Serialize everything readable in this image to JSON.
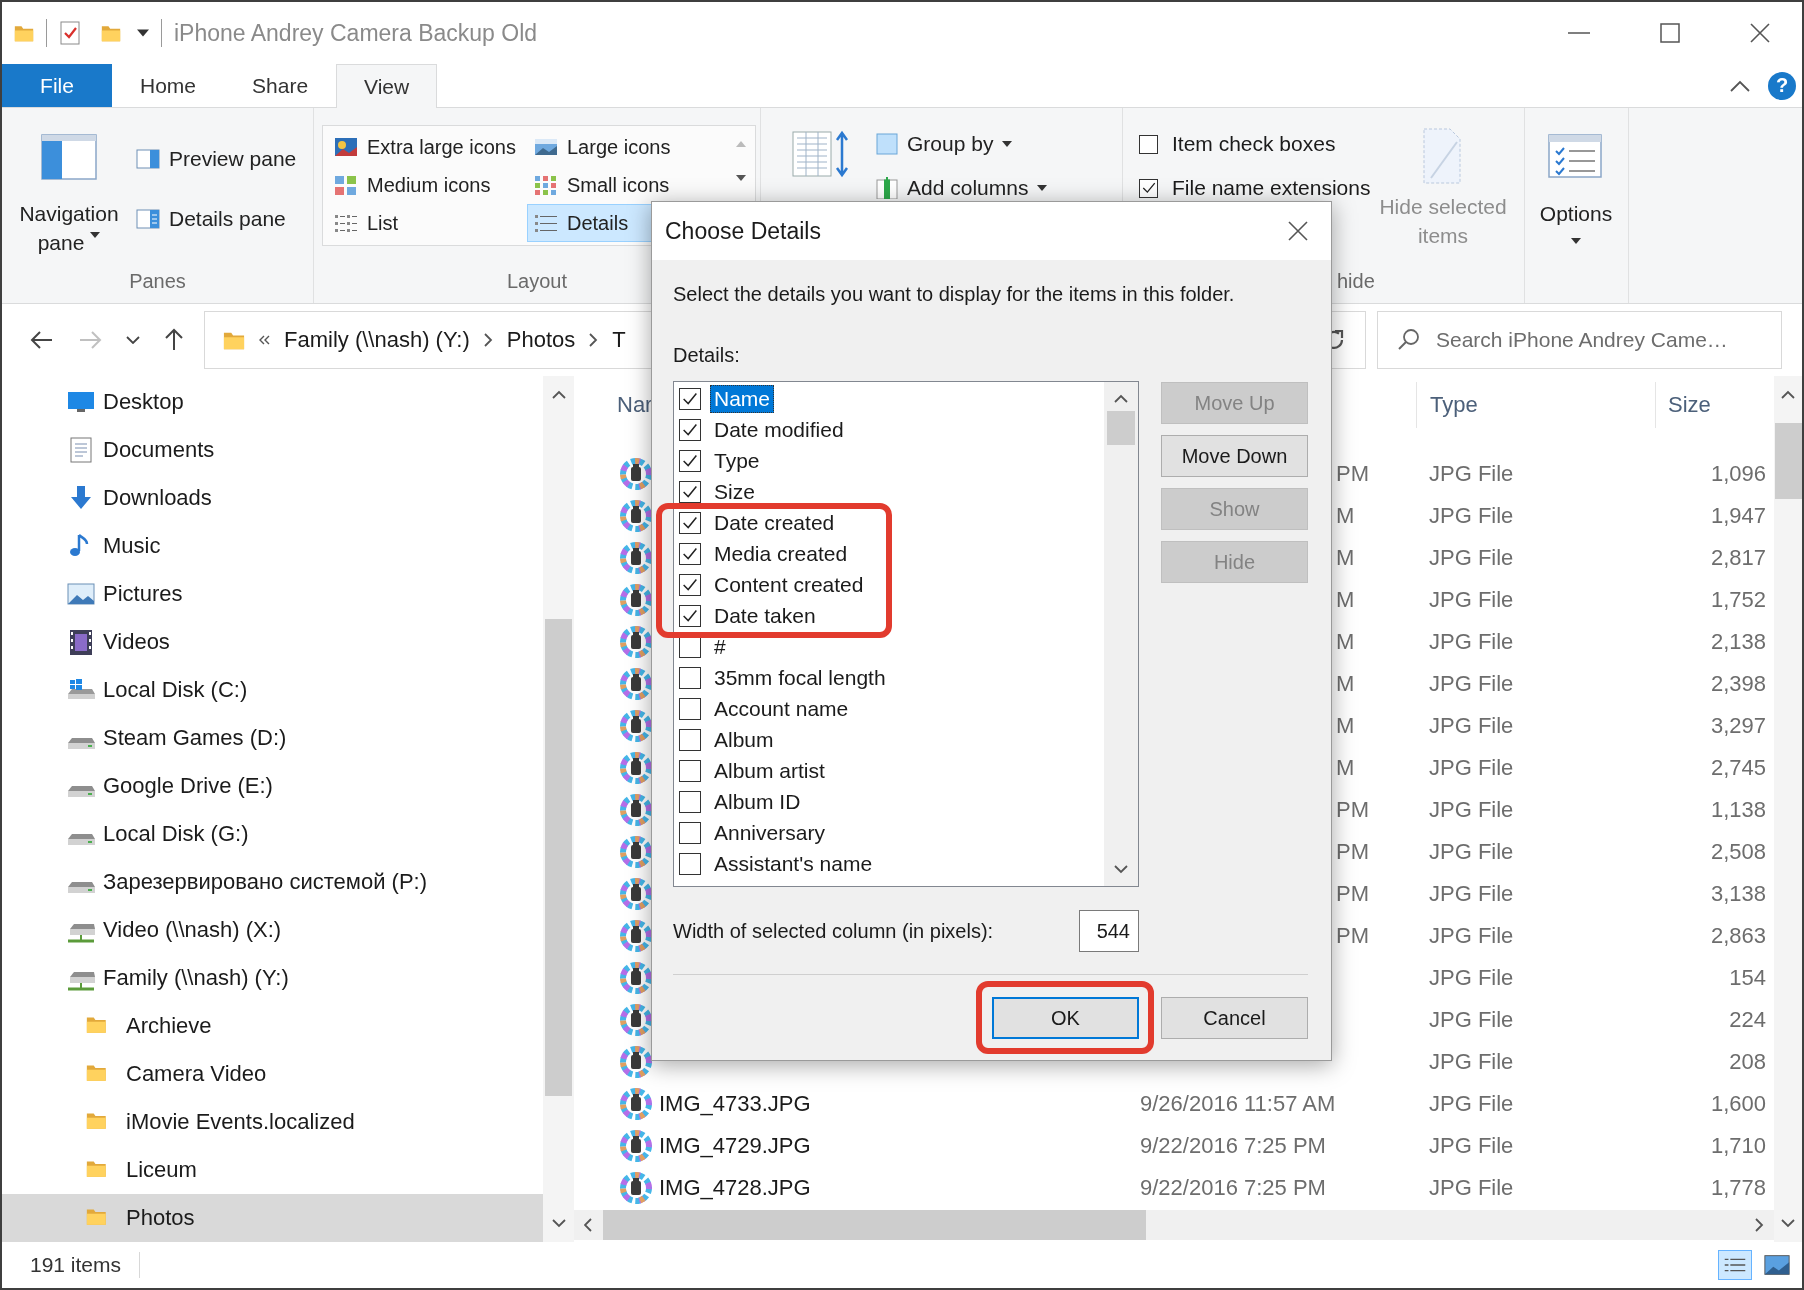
{
  "window": {
    "title": "iPhone Andrey Camera Backup Old"
  },
  "ribbon": {
    "tabs": [
      {
        "label": "File",
        "kind": "file",
        "selected": false
      },
      {
        "label": "Home",
        "kind": "tab",
        "selected": false
      },
      {
        "label": "Share",
        "kind": "tab",
        "selected": false
      },
      {
        "label": "View",
        "kind": "tab",
        "selected": true
      }
    ],
    "help": "?",
    "panes": {
      "label": "Panes",
      "navigation_pane": "Navigation pane",
      "buttons": [
        "Preview pane",
        "Details pane"
      ]
    },
    "layout": {
      "label": "Layout",
      "options": [
        {
          "label": "Extra large icons",
          "kind": "extra-large",
          "selected": false
        },
        {
          "label": "Large icons",
          "kind": "large",
          "selected": false
        },
        {
          "label": "Medium icons",
          "kind": "medium",
          "selected": false
        },
        {
          "label": "Small icons",
          "kind": "small",
          "selected": false
        },
        {
          "label": "List",
          "kind": "list",
          "selected": false
        },
        {
          "label": "Details",
          "kind": "details",
          "selected": true
        }
      ]
    },
    "current_view": {
      "group_by": "Group by",
      "add_columns": "Add columns"
    },
    "show_hide": {
      "label": "hide",
      "checkboxes": [
        {
          "label": "Item check boxes",
          "checked": false
        },
        {
          "label": "File name extensions",
          "checked": true
        }
      ],
      "hide_selected": {
        "label": "Hide selected items",
        "disabled": true
      }
    },
    "options": {
      "label": "Options"
    }
  },
  "address": {
    "nav": [
      {
        "kind": "back",
        "disabled": false
      },
      {
        "kind": "forward",
        "disabled": true
      },
      {
        "kind": "recent",
        "disabled": false
      },
      {
        "kind": "up",
        "disabled": false
      }
    ],
    "path": [
      "Family (\\\\nash) (Y:)",
      "Photos",
      "T"
    ],
    "search_placeholder": "Search iPhone Andrey Came…"
  },
  "sidebar": {
    "items": [
      {
        "label": "Desktop",
        "kind": "desktop",
        "selected": false
      },
      {
        "label": "Documents",
        "kind": "documents",
        "selected": false
      },
      {
        "label": "Downloads",
        "kind": "downloads",
        "selected": false
      },
      {
        "label": "Music",
        "kind": "music",
        "selected": false
      },
      {
        "label": "Pictures",
        "kind": "pictures",
        "selected": false
      },
      {
        "label": "Videos",
        "kind": "videos",
        "selected": false
      },
      {
        "label": "Local Disk (C:)",
        "kind": "system-drive",
        "selected": false
      },
      {
        "label": "Steam Games (D:)",
        "kind": "drive",
        "selected": false
      },
      {
        "label": "Google Drive (E:)",
        "kind": "drive",
        "selected": false
      },
      {
        "label": "Local Disk (G:)",
        "kind": "drive",
        "selected": false
      },
      {
        "label": "Зарезервировано системой (P:)",
        "kind": "drive",
        "selected": false
      },
      {
        "label": "Video (\\\\nash) (X:)",
        "kind": "network-drive",
        "selected": false
      },
      {
        "label": "Family (\\\\nash) (Y:)",
        "kind": "network-drive",
        "selected": false,
        "children": [
          {
            "label": "Archieve",
            "kind": "folder",
            "selected": false
          },
          {
            "label": "Camera Video",
            "kind": "folder",
            "selected": false
          },
          {
            "label": "iMovie Events.localized",
            "kind": "folder",
            "selected": false
          },
          {
            "label": "Liceum",
            "kind": "folder",
            "selected": false
          },
          {
            "label": "Photos",
            "kind": "folder",
            "selected": true
          }
        ]
      }
    ]
  },
  "files": {
    "columns": [
      {
        "kind": "name",
        "label": "Nar"
      },
      {
        "kind": "type",
        "label": "Type"
      },
      {
        "kind": "size",
        "label": "Size"
      }
    ],
    "rows": [
      {
        "kind": "covered",
        "date": "PM",
        "type": "JPG File",
        "size": "1,096"
      },
      {
        "kind": "covered",
        "date": "M",
        "type": "JPG File",
        "size": "1,947"
      },
      {
        "kind": "covered",
        "date": "M",
        "type": "JPG File",
        "size": "2,817"
      },
      {
        "kind": "covered",
        "date": "M",
        "type": "JPG File",
        "size": "1,752"
      },
      {
        "kind": "covered",
        "date": "M",
        "type": "JPG File",
        "size": "2,138"
      },
      {
        "kind": "covered",
        "date": "M",
        "type": "JPG File",
        "size": "2,398"
      },
      {
        "kind": "covered",
        "date": "M",
        "type": "JPG File",
        "size": "3,297"
      },
      {
        "kind": "covered",
        "date": "M",
        "type": "JPG File",
        "size": "2,745"
      },
      {
        "kind": "covered",
        "date": "PM",
        "type": "JPG File",
        "size": "1,138"
      },
      {
        "kind": "covered",
        "date": "PM",
        "type": "JPG File",
        "size": "2,508"
      },
      {
        "kind": "covered",
        "date": "PM",
        "type": "JPG File",
        "size": "3,138"
      },
      {
        "kind": "covered",
        "date": "PM",
        "type": "JPG File",
        "size": "2,863"
      },
      {
        "kind": "covered",
        "type": "JPG File",
        "size": "154"
      },
      {
        "kind": "covered",
        "type": "JPG File",
        "size": "224"
      },
      {
        "kind": "covered",
        "type": "JPG File",
        "size": "208"
      },
      {
        "kind": "visible",
        "name": "IMG_4733.JPG",
        "date": "9/26/2016 11:57 AM",
        "type": "JPG File",
        "size": "1,600"
      },
      {
        "kind": "visible",
        "name": "IMG_4729.JPG",
        "date": "9/22/2016 7:25 PM",
        "type": "JPG File",
        "size": "1,710"
      },
      {
        "kind": "visible",
        "name": "IMG_4728.JPG",
        "date": "9/22/2016 7:25 PM",
        "type": "JPG File",
        "size": "1,778"
      }
    ]
  },
  "status_bar": {
    "count": "191 items",
    "views": [
      {
        "kind": "details",
        "selected": true
      },
      {
        "kind": "large-icons",
        "selected": false
      }
    ]
  },
  "dialog": {
    "title": "Choose Details",
    "description": "Select the details you want to display for the items in this folder.",
    "list_label": "Details:",
    "items": [
      {
        "label": "Name",
        "checked": true,
        "selected": true,
        "highlighted": false
      },
      {
        "label": "Date modified",
        "checked": true,
        "selected": false,
        "highlighted": false
      },
      {
        "label": "Type",
        "checked": true,
        "selected": false,
        "highlighted": false
      },
      {
        "label": "Size",
        "checked": true,
        "selected": false,
        "highlighted": false
      },
      {
        "label": "Date created",
        "checked": true,
        "selected": false,
        "highlighted": true
      },
      {
        "label": "Media created",
        "checked": true,
        "selected": false,
        "highlighted": true
      },
      {
        "label": "Content created",
        "checked": true,
        "selected": false,
        "highlighted": true
      },
      {
        "label": "Date taken",
        "checked": true,
        "selected": false,
        "highlighted": true
      },
      {
        "label": "#",
        "checked": false,
        "selected": false,
        "highlighted": false
      },
      {
        "label": "35mm focal length",
        "checked": false,
        "selected": false,
        "highlighted": false
      },
      {
        "label": "Account name",
        "checked": false,
        "selected": false,
        "highlighted": false
      },
      {
        "label": "Album",
        "checked": false,
        "selected": false,
        "highlighted": false
      },
      {
        "label": "Album artist",
        "checked": false,
        "selected": false,
        "highlighted": false
      },
      {
        "label": "Album ID",
        "checked": false,
        "selected": false,
        "highlighted": false
      },
      {
        "label": "Anniversary",
        "checked": false,
        "selected": false,
        "highlighted": false
      },
      {
        "label": "Assistant's name",
        "checked": false,
        "selected": false,
        "highlighted": false
      }
    ],
    "buttons": [
      {
        "label": "Move Up",
        "disabled": true
      },
      {
        "label": "Move Down",
        "disabled": false
      },
      {
        "label": "Show",
        "disabled": true
      },
      {
        "label": "Hide",
        "disabled": true
      }
    ],
    "width_label": "Width of selected column (in pixels):",
    "width_value": "544",
    "ok": {
      "label": "OK",
      "default": true,
      "highlighted": true
    },
    "cancel": {
      "label": "Cancel"
    }
  }
}
